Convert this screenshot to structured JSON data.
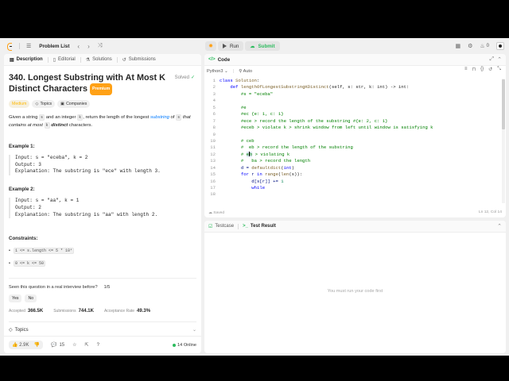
{
  "nav": {
    "title": "Problem List",
    "run_label": "Run",
    "submit_label": "Submit",
    "streak": "0"
  },
  "left_tabs": [
    {
      "label": "Description"
    },
    {
      "label": "Editorial"
    },
    {
      "label": "Solutions"
    },
    {
      "label": "Submissions"
    }
  ],
  "problem": {
    "title": "340. Longest Substring with At Most K Distinct Characters",
    "solved_label": "Solved",
    "premium_label": "Premium",
    "difficulty": "Medium",
    "topics_chip": "Topics",
    "companies_chip": "Companies",
    "desc_1": "Given a string ",
    "desc_s": "s",
    "desc_2": " and an integer ",
    "desc_k": "k",
    "desc_3": ", return the length of the longest ",
    "desc_link": "substring",
    "desc_4": " of ",
    "desc_s2": "s",
    "desc_5": " that contains at most ",
    "desc_k2": "k",
    "desc_6": " distinct",
    "desc_7": " characters.",
    "ex1_title": "Example 1:",
    "ex1_input": "Input: s = \"eceba\", k = 2",
    "ex1_output": "Output: 3",
    "ex1_expl": "Explanation: The substring is \"ece\" with length 3.",
    "ex2_title": "Example 2:",
    "ex2_input": "Input: s = \"aa\", k = 1",
    "ex2_output": "Output: 2",
    "ex2_expl": "Explanation: The substring is \"aa\" with length 2.",
    "constraints_title": "Constraints:",
    "c1": "1 <= s.length <= 5 * 10⁴",
    "c2": "0 <= k <= 50",
    "seen_q": "Seen this question in a real interview before?",
    "seen_count": "1/5",
    "yes": "Yes",
    "no": "No",
    "accepted_label": "Accepted",
    "accepted_value": "366.5K",
    "submissions_label": "Submissions",
    "submissions_value": "744.1K",
    "rate_label": "Acceptance Rate",
    "rate_value": "49.3%",
    "topics_section": "Topics"
  },
  "bottom": {
    "likes": "2.9K",
    "comments": "15",
    "online": "14 Online"
  },
  "code_panel": {
    "title": "Code",
    "language": "Python3",
    "auto": "Auto",
    "saved": "Saved",
    "cursor": "Ln 12, Col 14",
    "lines": [
      {
        "n": "1"
      },
      {
        "n": "2"
      },
      {
        "n": "3"
      },
      {
        "n": "4"
      },
      {
        "n": "5"
      },
      {
        "n": "6"
      },
      {
        "n": "7"
      },
      {
        "n": "8"
      },
      {
        "n": "9"
      },
      {
        "n": "10"
      },
      {
        "n": "11"
      },
      {
        "n": "12"
      },
      {
        "n": "13"
      },
      {
        "n": "14"
      },
      {
        "n": "15"
      },
      {
        "n": "16"
      },
      {
        "n": "17"
      },
      {
        "n": "18"
      }
    ],
    "code": {
      "l1a": "class ",
      "l1b": "Solution",
      "l1c": ":",
      "l2a": "    def ",
      "l2b": "lengthOfLongestSubstringKDistinct",
      "l2c": "(self, s: str, k: int) -> int:",
      "l3": "        #s = \"eceba\"",
      "l5": "        #e",
      "l6": "        #ec {e: 1, c: 1}",
      "l7": "        #ece > record the length of the substring #{e: 2, c: 1}",
      "l8": "        #eceb > violate k > shrink window from left until window is satisfying k",
      "l10": "        # ceb",
      "l11": "        #  eb > record the length of the substring",
      "l12a": "        # ",
      "l12b": "e",
      "l12c": "b",
      "l12d": " > violating k",
      "l13": "        #   ba > record the length",
      "l14a": "        d = ",
      "l14b": "defaultdict",
      "l14c": "(",
      "l14d": "int",
      "l14e": ")",
      "l15a": "        for ",
      "l15b": "r ",
      "l15c": "in ",
      "l15d": "range",
      "l15e": "(",
      "l15f": "len",
      "l15g": "(s)):",
      "l16a": "            d[s[r]] += ",
      "l16b": "1",
      "l17": "            while"
    }
  },
  "result_panel": {
    "tab1": "Testcase",
    "tab2": "Test Result",
    "empty": "You must run your code first"
  }
}
